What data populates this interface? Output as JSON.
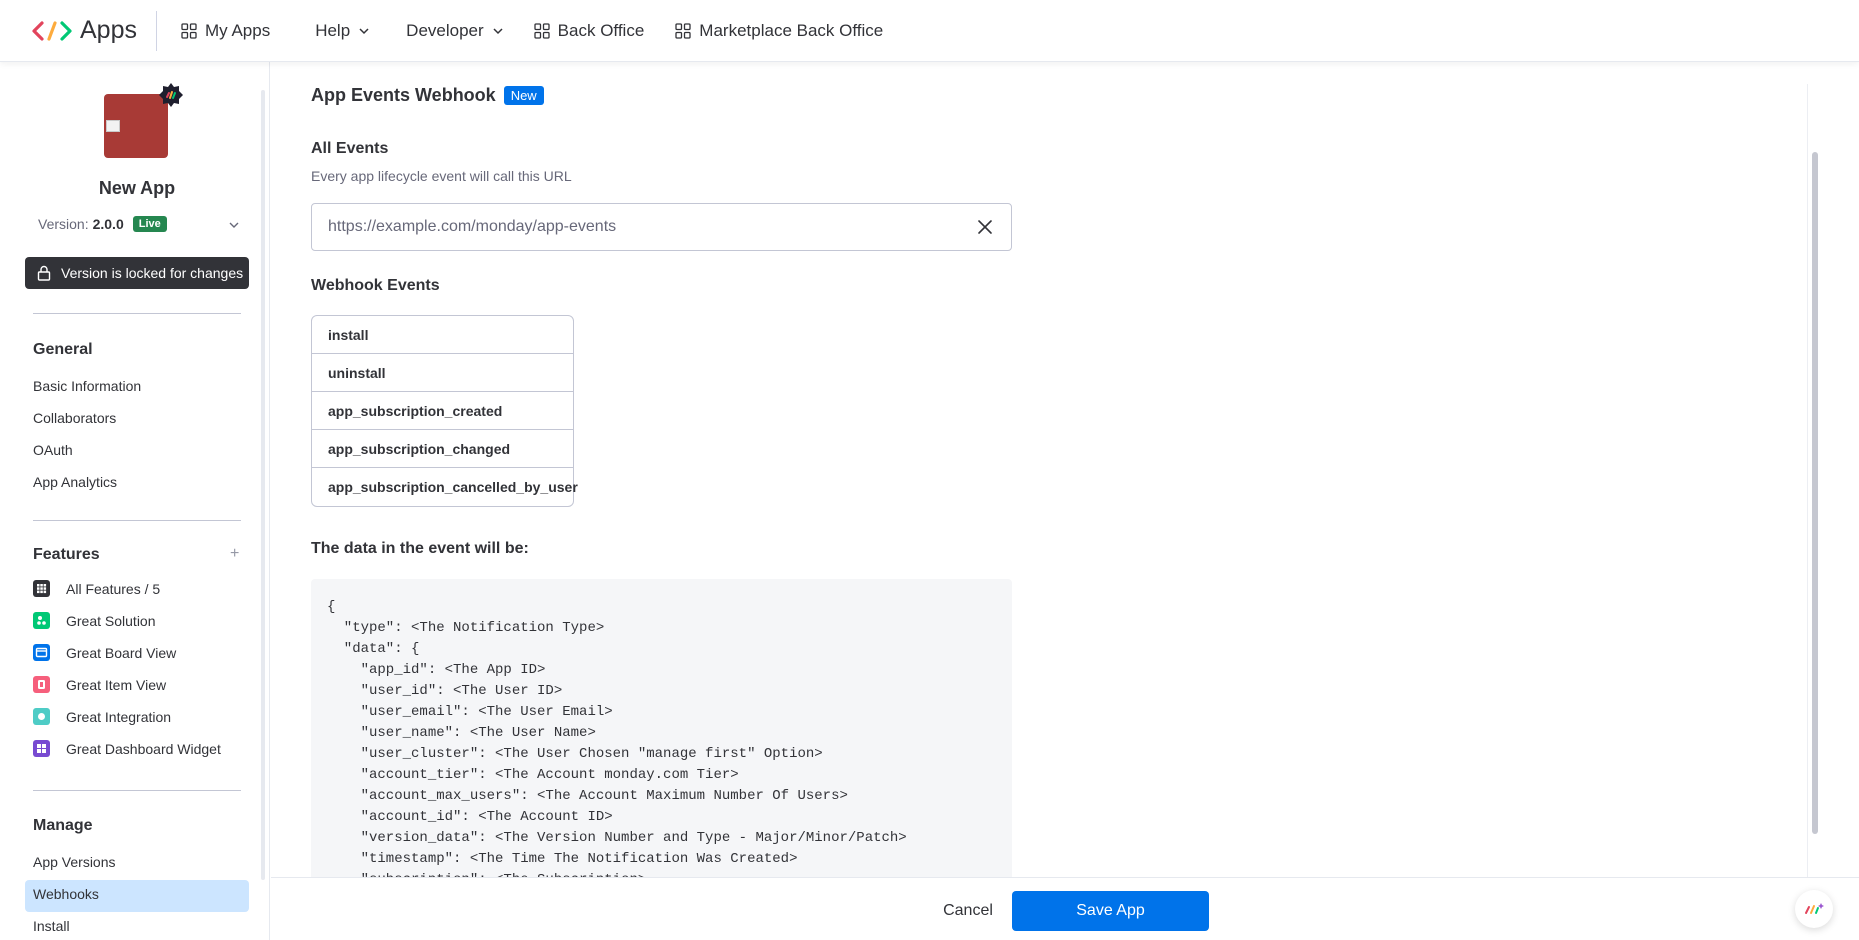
{
  "brand": {
    "name": "Apps",
    "colors": {
      "red": "#e2445c",
      "yellow": "#fdab3d",
      "green": "#00c875"
    }
  },
  "topnav": {
    "my_apps": "My Apps",
    "help": "Help",
    "developer": "Developer",
    "back_office": "Back Office",
    "marketplace_back_office": "Marketplace Back Office"
  },
  "sidebar": {
    "app_name": "New App",
    "version_label": "Version:",
    "version_number": "2.0.0",
    "live_badge": "Live",
    "locked_text": "Version is locked for changes",
    "general": {
      "title": "General",
      "items": [
        "Basic Information",
        "Collaborators",
        "OAuth",
        "App Analytics"
      ]
    },
    "features": {
      "title": "Features",
      "add_symbol": "+",
      "items": [
        {
          "label": "All Features / 5",
          "icon": "grid-icon",
          "color": "#323338"
        },
        {
          "label": "Great Solution",
          "icon": "solution-icon",
          "color": "#00c875"
        },
        {
          "label": "Great Board View",
          "icon": "board-view-icon",
          "color": "#0073ea"
        },
        {
          "label": "Great Item View",
          "icon": "item-view-icon",
          "color": "#f65f7c"
        },
        {
          "label": "Great Integration",
          "icon": "integration-icon",
          "color": "#4eccc6"
        },
        {
          "label": "Great Dashboard Widget",
          "icon": "dashboard-widget-icon",
          "color": "#784bd1"
        }
      ]
    },
    "manage": {
      "title": "Manage",
      "items": [
        "App Versions",
        "Webhooks",
        "Install"
      ],
      "active": "Webhooks"
    }
  },
  "main": {
    "title": "App Events Webhook",
    "new_badge": "New",
    "all_events_label": "All Events",
    "all_events_desc": "Every app lifecycle event will call this URL",
    "url_placeholder": "https://example.com/monday/app-events",
    "url_value": "",
    "webhook_events_label": "Webhook Events",
    "webhook_events": [
      "install",
      "uninstall",
      "app_subscription_created",
      "app_subscription_changed",
      "app_subscription_cancelled_by_user"
    ],
    "data_label": "The data in the event will be:",
    "code": "{\n  \"type\": <The Notification Type>\n  \"data\": {\n    \"app_id\": <The App ID>\n    \"user_id\": <The User ID>\n    \"user_email\": <The User Email>\n    \"user_name\": <The User Name>\n    \"user_cluster\": <The User Chosen \"manage first\" Option>\n    \"account_tier\": <The Account monday.com Tier>\n    \"account_max_users\": <The Account Maximum Number Of Users>\n    \"account_id\": <The Account ID>\n    \"version_data\": <The Version Number and Type - Major/Minor/Patch>\n    \"timestamp\": <The Time The Notification Was Created>\n    \"subscription\": <The Subscription>"
  },
  "footer": {
    "cancel": "Cancel",
    "save": "Save App"
  }
}
